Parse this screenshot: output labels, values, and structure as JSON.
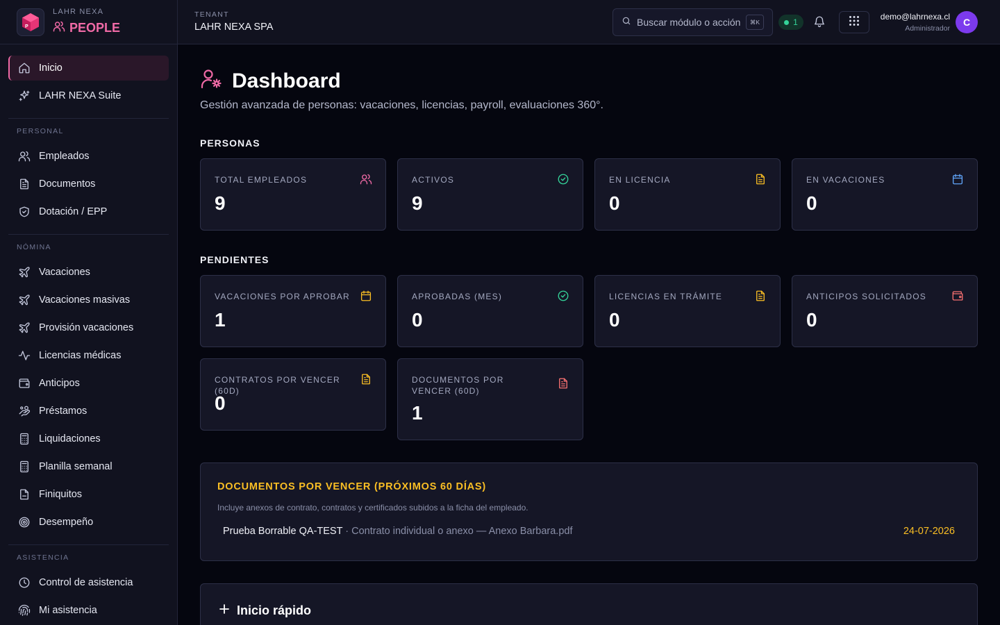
{
  "brand": {
    "company": "LAHR NEXA",
    "product": "PEOPLE",
    "logo_letter": "P"
  },
  "sidebar": {
    "top": [
      {
        "label": "Inicio",
        "icon": "home-icon"
      },
      {
        "label": "LAHR NEXA Suite",
        "icon": "sparkles-icon"
      }
    ],
    "sections": [
      {
        "title": "PERSONAL",
        "items": [
          {
            "label": "Empleados",
            "icon": "users-icon"
          },
          {
            "label": "Documentos",
            "icon": "document-icon"
          },
          {
            "label": "Dotación / EPP",
            "icon": "shield-check-icon"
          }
        ]
      },
      {
        "title": "NÓMINA",
        "items": [
          {
            "label": "Vacaciones",
            "icon": "plane-icon"
          },
          {
            "label": "Vacaciones masivas",
            "icon": "plane-icon"
          },
          {
            "label": "Provisión vacaciones",
            "icon": "plane-icon"
          },
          {
            "label": "Licencias médicas",
            "icon": "activity-icon"
          },
          {
            "label": "Anticipos",
            "icon": "wallet-icon"
          },
          {
            "label": "Préstamos",
            "icon": "hand-coins-icon"
          },
          {
            "label": "Liquidaciones",
            "icon": "calculator-icon"
          },
          {
            "label": "Planilla semanal",
            "icon": "calculator-icon"
          },
          {
            "label": "Finiquitos",
            "icon": "file-icon"
          },
          {
            "label": "Desempeño",
            "icon": "target-icon"
          }
        ]
      },
      {
        "title": "ASISTENCIA",
        "items": [
          {
            "label": "Control de asistencia",
            "icon": "clock-icon"
          },
          {
            "label": "Mi asistencia",
            "icon": "fingerprint-icon"
          }
        ]
      }
    ]
  },
  "topbar": {
    "tenant_label": "TENANT",
    "tenant_name": "LAHR NEXA SPA",
    "search_placeholder": "Buscar módulo o acción",
    "search_shortcut": "⌘K",
    "status_count": "1",
    "user_email": "demo@lahrnexa.cl",
    "user_role": "Administrador",
    "avatar_initial": "C"
  },
  "page": {
    "title": "Dashboard",
    "subtitle": "Gestión avanzada de personas: vacaciones, licencias, payroll, evaluaciones 360°."
  },
  "personas": {
    "title": "PERSONAS",
    "cards": [
      {
        "label": "TOTAL EMPLEADOS",
        "value": "9",
        "icon": "users-icon",
        "color": "#f06aa6"
      },
      {
        "label": "ACTIVOS",
        "value": "9",
        "icon": "check-circle-icon",
        "color": "#34d399"
      },
      {
        "label": "EN LICENCIA",
        "value": "0",
        "icon": "document-icon",
        "color": "#fbbf24"
      },
      {
        "label": "EN VACACIONES",
        "value": "0",
        "icon": "calendar-icon",
        "color": "#60a5fa"
      }
    ]
  },
  "pendientes": {
    "title": "PENDIENTES",
    "cards": [
      {
        "label": "VACACIONES POR APROBAR",
        "value": "1",
        "icon": "calendar-icon",
        "color": "#fbbf24"
      },
      {
        "label": "APROBADAS (MES)",
        "value": "0",
        "icon": "check-circle-icon",
        "color": "#34d399"
      },
      {
        "label": "LICENCIAS EN TRÁMITE",
        "value": "0",
        "icon": "document-icon",
        "color": "#fbbf24"
      },
      {
        "label": "ANTICIPOS SOLICITADOS",
        "value": "0",
        "icon": "wallet-icon",
        "color": "#f87171"
      },
      {
        "label": "CONTRATOS POR VENCER (60D)",
        "value": "0",
        "icon": "document-icon",
        "color": "#fbbf24"
      },
      {
        "label": "DOCUMENTOS POR VENCER (60D)",
        "value": "1",
        "icon": "document-icon",
        "color": "#f87171"
      }
    ]
  },
  "docs_panel": {
    "title": "DOCUMENTOS POR VENCER (PRÓXIMOS 60 DÍAS)",
    "description": "Incluye anexos de contrato, contratos y certificados subidos a la ficha del empleado.",
    "rows": [
      {
        "employee": "Prueba Borrable QA-TEST",
        "separator": " · ",
        "detail": "Contrato individual o anexo — Anexo Barbara.pdf",
        "date": "24-07-2026"
      }
    ]
  },
  "quick_start": {
    "title": "Inicio rápido"
  },
  "colors": {
    "accent": "#f06aa6",
    "warning": "#fbbf24",
    "success": "#34d399",
    "info": "#60a5fa",
    "danger": "#f87171",
    "avatar": "#7c3aed"
  }
}
